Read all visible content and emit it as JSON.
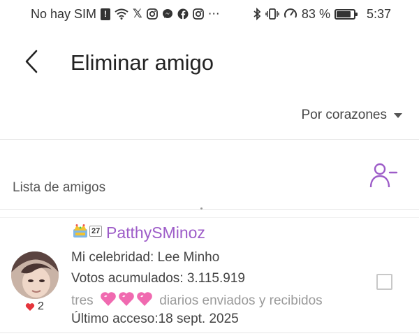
{
  "status_bar": {
    "carrier": "No hay SIM",
    "battery_percent": "83 %",
    "time": "5:37"
  },
  "header": {
    "title": "Eliminar amigo"
  },
  "sort": {
    "label": "Por corazones"
  },
  "section": {
    "label": "Lista de amigos"
  },
  "friend": {
    "level": "27",
    "name": "PatthySMinoz",
    "celebrity": "Mi celebridad: Lee Minho",
    "votes": "Votos acumulados: 3.115.919",
    "daily_prefix": "tres",
    "daily_suffix": "diarios enviados y recibidos",
    "last_access": "Último acceso:18 sept. 2025",
    "likes": "2",
    "selected": false
  },
  "colors": {
    "accent": "#9d5cc8",
    "heart_pink": "#f06ab0",
    "like_heart": "#e5353c"
  },
  "icons": {
    "back": "chevron-left-icon",
    "add_friend": "person-minus-icon",
    "sort_caret": "caret-down-icon"
  }
}
